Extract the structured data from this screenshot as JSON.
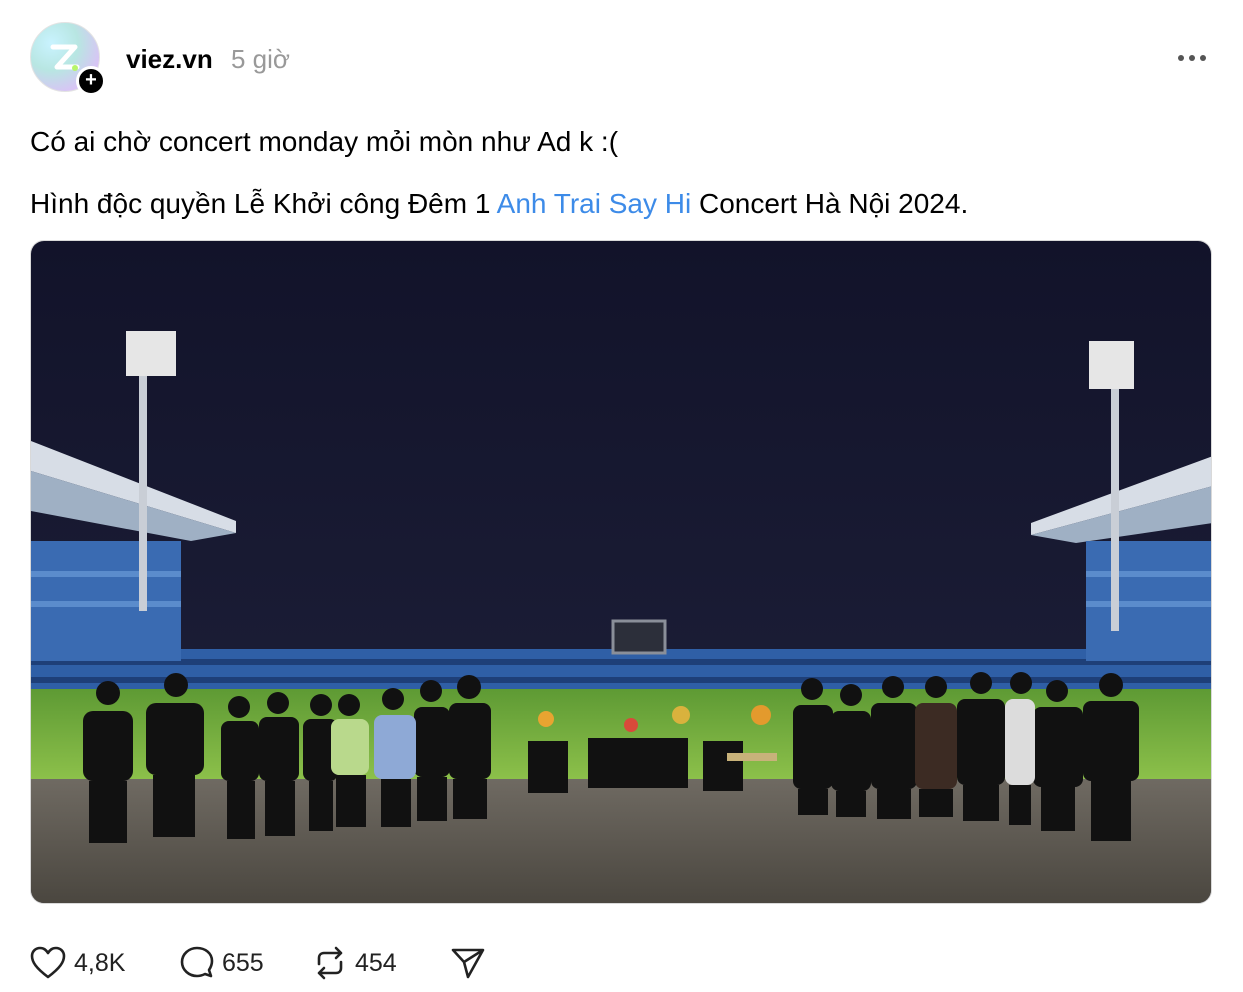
{
  "post": {
    "username": "viez.vn",
    "time": "5 giờ",
    "line1": "Có ai chờ concert monday mỏi mòn như Ad k :(",
    "line2_before": "Hình độc quyền Lễ Khởi công Đêm 1 ",
    "line2_link": "Anh Trai Say Hi",
    "line2_after": " Concert Hà Nội 2024.",
    "image_description": "Night photo in a stadium: a group of people posing on the pitch around ceremonial altar tables"
  },
  "actions": {
    "likes": "4,8K",
    "comments": "655",
    "reposts": "454"
  },
  "icons": [
    "avatar-logo-icon",
    "follow-plus-icon",
    "more-options-icon",
    "heart-icon",
    "comment-icon",
    "repost-icon",
    "share-icon"
  ],
  "colors": {
    "link": "#3d8be8",
    "muted": "#999999",
    "sky": "#141528",
    "pitch": "#6fa83a"
  }
}
